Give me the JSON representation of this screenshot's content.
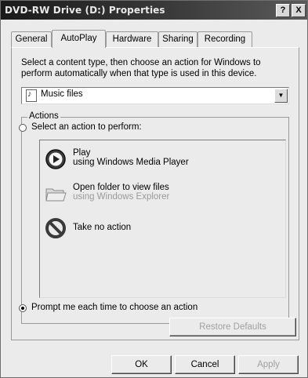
{
  "window": {
    "title": "DVD-RW Drive (D:) Properties",
    "help_label": "?",
    "close_label": "X"
  },
  "tabs": [
    "General",
    "AutoPlay",
    "Hardware",
    "Sharing",
    "Recording"
  ],
  "active_tab": "AutoPlay",
  "description": "Select a content type, then choose an action for Windows to perform automatically when that type is used in this device.",
  "content_type": {
    "selected": "Music files",
    "icon": "music-file-icon"
  },
  "actions": {
    "legend": "Actions",
    "select_action_label": "Select an action to perform:",
    "select_action_checked": false,
    "items": [
      {
        "title": "Play",
        "subtitle": "using Windows Media Player",
        "icon": "play-icon",
        "enabled": true
      },
      {
        "title": "Open folder to view files",
        "subtitle": "using Windows Explorer",
        "icon": "folder-icon",
        "enabled": false
      },
      {
        "title": "Take no action",
        "subtitle": "",
        "icon": "no-action-icon",
        "enabled": true
      }
    ],
    "prompt_label": "Prompt me each time to choose an action",
    "prompt_checked": true
  },
  "buttons": {
    "restore_defaults": "Restore Defaults",
    "ok": "OK",
    "cancel": "Cancel",
    "apply": "Apply"
  },
  "colors": {
    "title_bar": "#2a2a2a",
    "dialog_background": "#ebebeb",
    "disabled_text": "#9a9a9a"
  }
}
